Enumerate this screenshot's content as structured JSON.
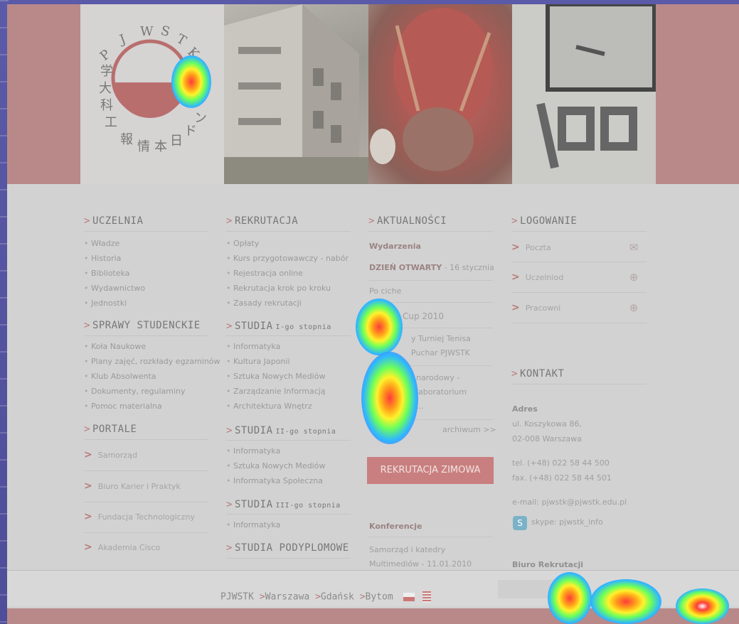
{
  "banner": {
    "logo_text": "PJWSTK",
    "logo_kanji": "日本情報工科大学"
  },
  "uczelnia": {
    "heading": "UCZELNIA",
    "items": [
      "Władze",
      "Historia",
      "Biblioteka",
      "Wydawnictwo",
      "Jednostki"
    ]
  },
  "sprawy": {
    "heading": "SPRAWY STUDENCKIE",
    "items": [
      "Koła Naukowe",
      "Plany zajęć, rozkłady egzaminów",
      "Klub Absolwenta",
      "Dokumenty, regulaminy",
      "Pomoc materialna"
    ]
  },
  "portale": {
    "heading": "PORTALE",
    "items": [
      "Samorząd",
      "Biuro Karier i Praktyk",
      "Fundacja Technologiczny",
      "Akademia Cisco"
    ]
  },
  "rekrutacja": {
    "heading": "REKRUTACJA",
    "items": [
      "Opłaty",
      "Kurs przygotowawczy - nabór",
      "Rejestracja online",
      "Rekrutacja krok po kroku",
      "Zasady rekrutacji"
    ]
  },
  "studia1": {
    "heading": "STUDIA",
    "sub": "I-go stopnia",
    "items": [
      "Informatyka",
      "Kultura Japonii",
      "Sztuka Nowych Mediów",
      "Zarządzanie Informacją",
      "Architektura Wnętrz"
    ]
  },
  "studia2": {
    "heading": "STUDIA",
    "sub": "II-go stopnia",
    "items": [
      "Informatyka",
      "Sztuka Nowych Mediów",
      "Informatyka Społeczna"
    ]
  },
  "studia3": {
    "heading": "STUDIA",
    "sub": "III-go stopnia",
    "items": [
      "Informatyka"
    ]
  },
  "podyplomowe": {
    "heading": "STUDIA PODYPLOMOWE"
  },
  "aktualnosci": {
    "heading": "AKTUALNOŚCI",
    "wydarzenia_label": "Wydarzenia",
    "event1_title": "DZIEŃ OTWARTY",
    "event1_date": "- 16 stycznia",
    "event2": "Po ciche",
    "event3": "Cup 2010",
    "event4_a": "y Turniej Tenisa",
    "event4_b": "Puchar PJWSTK",
    "event5_a": "narodowy -",
    "event5_b": "laboratorium",
    "event5_c": "...",
    "archiwum": "archiwum >>",
    "recruit_button": "REKRUTACJA ZIMOWA",
    "konferencje_label": "Konferencje",
    "konf_a": "Samorząd i katedry",
    "konf_b": "Multimediów - 11.01.2010"
  },
  "logowanie": {
    "heading": "LOGOWANIE",
    "items": [
      "Poczta",
      "Uczelniod",
      "Pracowni"
    ]
  },
  "kontakt": {
    "heading": "KONTAKT",
    "adres_label": "Adres",
    "street": "ul. Koszykowa 86,",
    "city": "02-008 Warszawa",
    "tel": "tel. (+48) 022 58 44 500",
    "fax": "fax. (+48) 022 58 44 501",
    "email": "e-mail: pjwstk@pjwstk.edu.pl",
    "skype": "skype: pjwstk_info",
    "biuro": "Biuro Rekrutacji"
  },
  "footer": {
    "home": "PJWSTK",
    "links": [
      "Warszawa",
      "Gdańsk",
      "Bytom"
    ]
  }
}
